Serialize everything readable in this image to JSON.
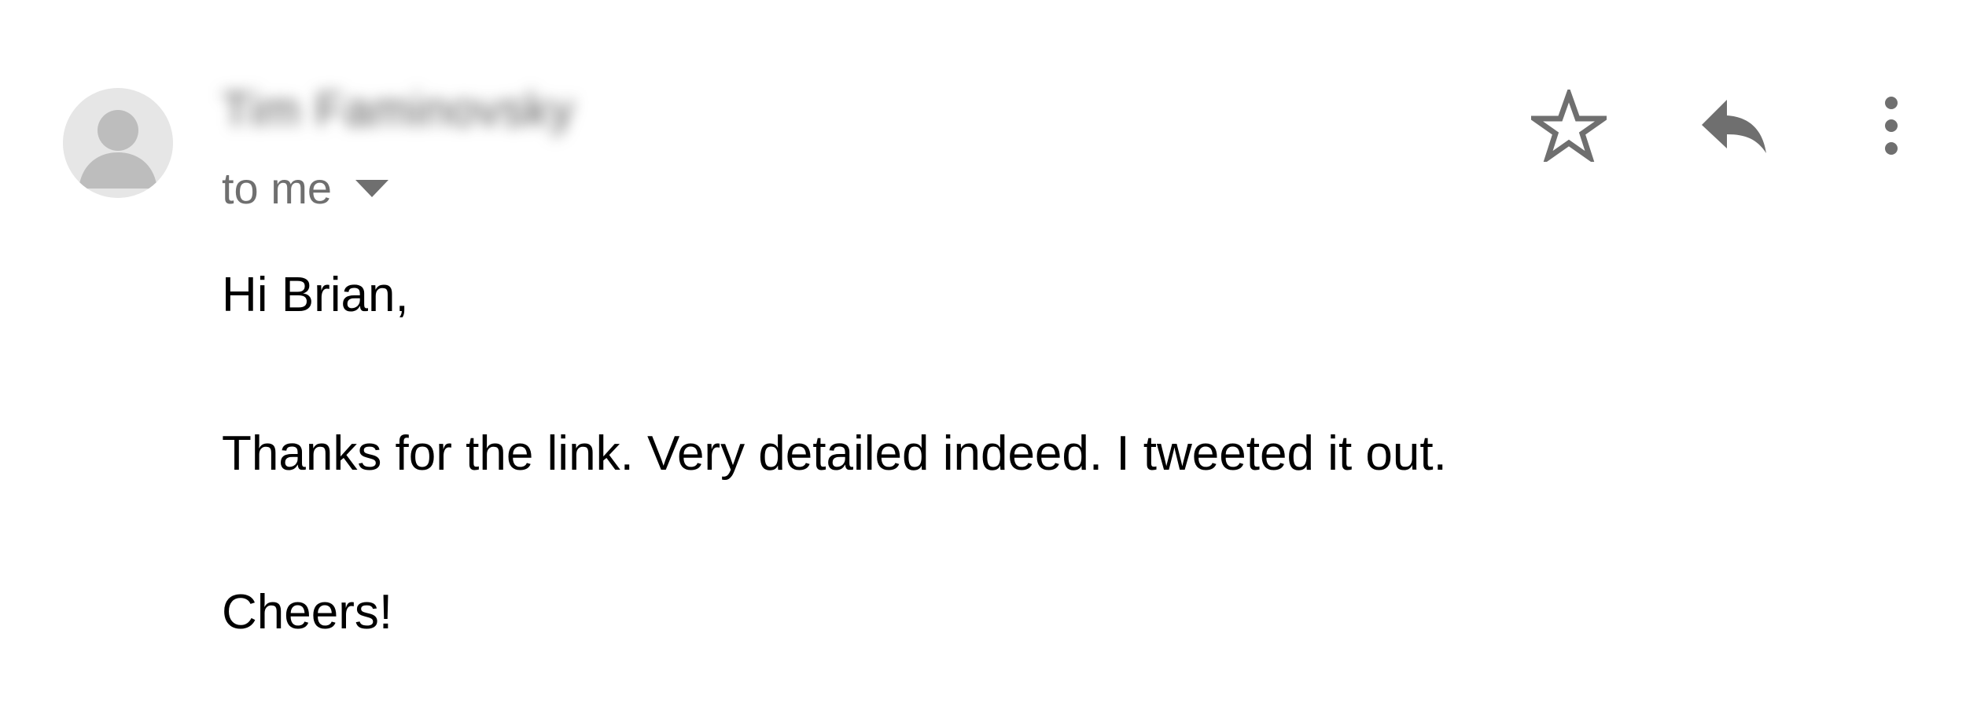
{
  "email": {
    "sender": {
      "name": "Tim Faminovsky",
      "name_blurred": true
    },
    "recipient_label": "to me",
    "actions": {
      "star_icon": "star-outline-icon",
      "reply_icon": "reply-icon",
      "more_icon": "more-vertical-icon"
    },
    "body": {
      "greeting": "Hi Brian,",
      "message": "Thanks for the link. Very detailed indeed. I tweeted it out.",
      "signoff": "Cheers!"
    }
  },
  "colors": {
    "avatar_bg": "#e6e6e6",
    "avatar_fg": "#bdbdbd",
    "icon_gray": "#6f6f6f",
    "body_text": "#000000"
  }
}
